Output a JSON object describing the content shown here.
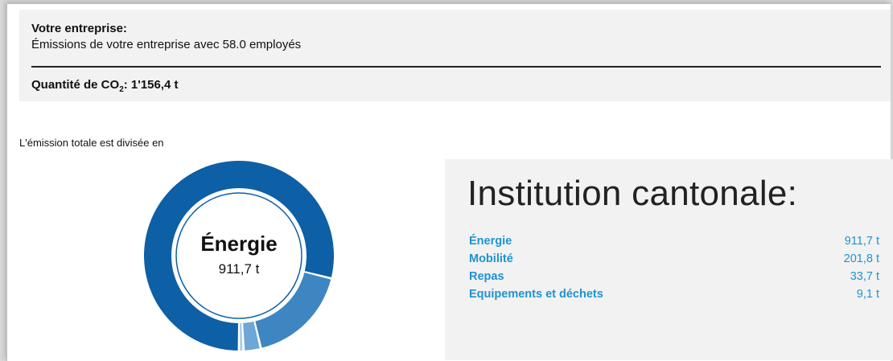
{
  "summary": {
    "heading": "Votre entreprise:",
    "description": "Émissions de votre entreprise avec 58.0 employés",
    "quantity_label_prefix": "Quantité de CO",
    "quantity_label_subscript": "2",
    "quantity_label_suffix": ": 1'156,4 t"
  },
  "intro_text": "L'émission totale est divisée en",
  "donut": {
    "center_title": "Énergie",
    "center_value": "911,7 t"
  },
  "panel": {
    "title": "Institution cantonale:",
    "rows": [
      {
        "label": "Énergie",
        "value": "911,7 t"
      },
      {
        "label": "Mobilité",
        "value": "201,8 t"
      },
      {
        "label": "Repas",
        "value": "33,7 t"
      },
      {
        "label": "Equipements et déchets",
        "value": "9,1 t"
      }
    ]
  },
  "chart_data": {
    "type": "pie",
    "categories": [
      "Énergie",
      "Mobilité",
      "Repas",
      "Equipements et déchets"
    ],
    "values": [
      911.7,
      201.8,
      33.7,
      9.1
    ],
    "colors": [
      "#0d5fa6",
      "#3d86c2",
      "#6ea6d6",
      "#a9c9e8"
    ]
  },
  "colors": {
    "accent": "#1e93d2",
    "panel_bg": "#f2f2f2"
  }
}
